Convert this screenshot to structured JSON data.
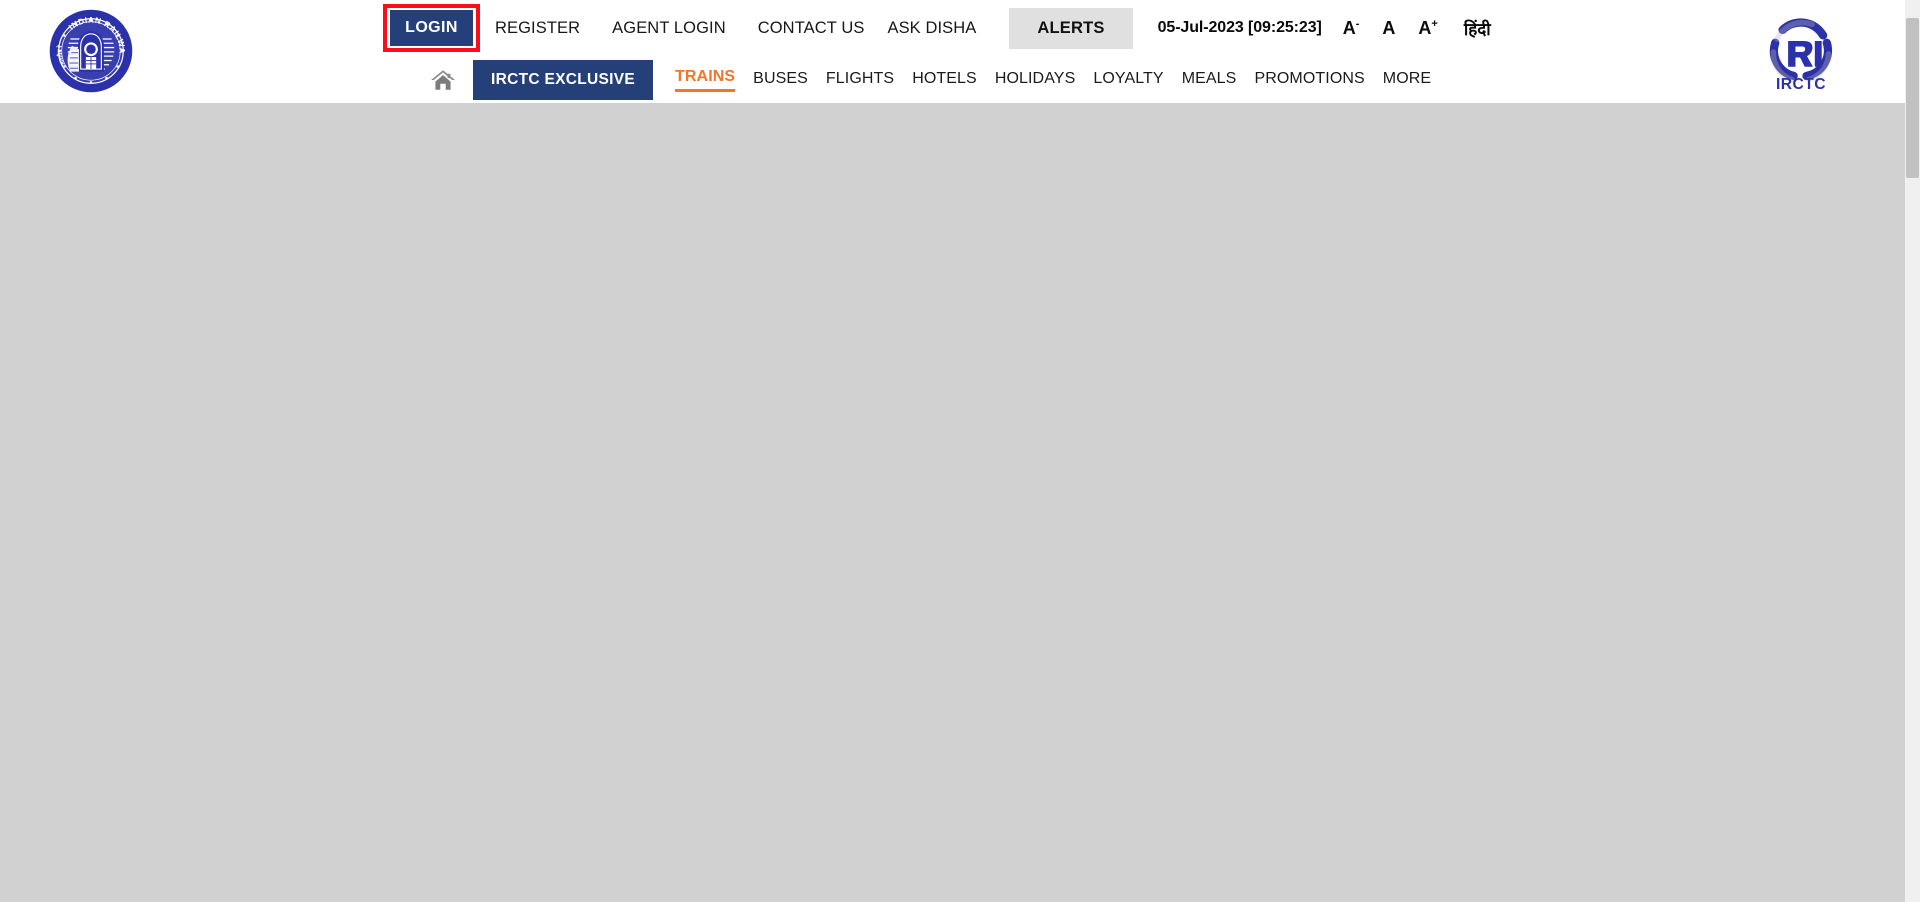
{
  "site": {
    "name": "IRCTC",
    "brand_navy": "#254078",
    "brand_orange": "#f4762a",
    "highlight_red": "#fc0d1b",
    "body_gray": "#d1d1d1"
  },
  "emblem": {
    "name": "Indian Railways",
    "text_top": "INDIAN RAILWAYS",
    "text_left": "भारतीय रेल"
  },
  "logo": {
    "text": "IRCTC"
  },
  "topnav": {
    "login_label": "LOGIN",
    "links": [
      {
        "label": "REGISTER",
        "name": "register"
      },
      {
        "label": "AGENT LOGIN",
        "name": "agent-login"
      },
      {
        "label": "CONTACT US",
        "name": "contact-us"
      },
      {
        "label": "ASK DISHA",
        "name": "ask-disha"
      }
    ],
    "alerts_label": "ALERTS",
    "datetime": "05-Jul-2023 [09:25:23]",
    "font_decrease": "A",
    "font_decrease_sup": "-",
    "font_normal": "A",
    "font_increase": "A",
    "font_increase_sup": "+",
    "language_label": "हिंदी"
  },
  "mainnav": {
    "home_icon": "home-icon",
    "exclusive_label": "IRCTC EXCLUSIVE",
    "items": [
      {
        "label": "TRAINS",
        "name": "trains",
        "active": true
      },
      {
        "label": "BUSES",
        "name": "buses",
        "active": false
      },
      {
        "label": "FLIGHTS",
        "name": "flights",
        "active": false
      },
      {
        "label": "HOTELS",
        "name": "hotels",
        "active": false
      },
      {
        "label": "HOLIDAYS",
        "name": "holidays",
        "active": false
      },
      {
        "label": "LOYALTY",
        "name": "loyalty",
        "active": false
      },
      {
        "label": "MEALS",
        "name": "meals",
        "active": false
      },
      {
        "label": "PROMOTIONS",
        "name": "promotions",
        "active": false
      },
      {
        "label": "MORE",
        "name": "more",
        "active": false
      }
    ]
  },
  "content": {
    "body_text": ""
  }
}
